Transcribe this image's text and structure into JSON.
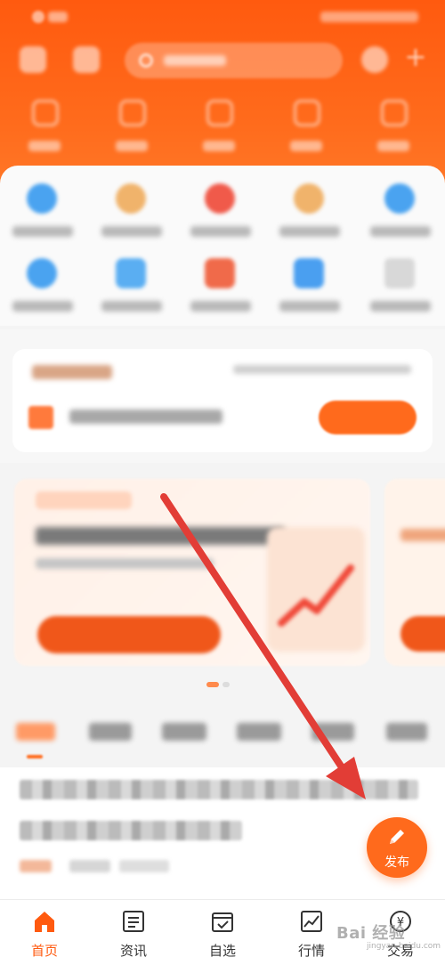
{
  "fab": {
    "label": "发布",
    "icon": "pen-icon"
  },
  "bottom_nav": [
    {
      "label": "首页",
      "icon": "home-icon",
      "active": true
    },
    {
      "label": "资讯",
      "icon": "news-icon",
      "active": false
    },
    {
      "label": "自选",
      "icon": "watchlist-icon",
      "active": false
    },
    {
      "label": "行情",
      "icon": "chart-icon",
      "active": false
    },
    {
      "label": "交易",
      "icon": "yuan-icon",
      "active": false
    }
  ],
  "watermark": {
    "main": "Bai 经验",
    "sub": "jingyan.baidu.com"
  },
  "colors": {
    "accent": "#ff6a1c",
    "header": "#ff5a0f",
    "arrow": "#e23d36"
  }
}
